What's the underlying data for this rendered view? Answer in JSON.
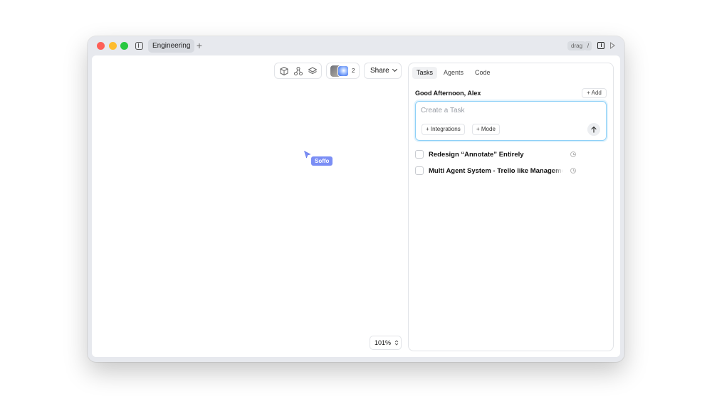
{
  "titlebar": {
    "tab_label": "Engineering",
    "add_tab_symbol": "+",
    "drag_label": "drag",
    "shortcut_label": "/"
  },
  "toolbar": {
    "icons": [
      "cube-icon",
      "nodes-icon",
      "layers-icon"
    ],
    "collaborators_count": "2",
    "share_label": "Share"
  },
  "canvas": {
    "cursor_user": "Soffo",
    "cursor_color": "#7b8ef5",
    "zoom_label": "101%"
  },
  "panel": {
    "tabs": [
      {
        "label": "Tasks",
        "active": true
      },
      {
        "label": "Agents",
        "active": false
      },
      {
        "label": "Code",
        "active": false
      }
    ],
    "greeting": "Good Afternoon, Alex",
    "add_label": "+ Add",
    "task_placeholder": "Create a Task",
    "integrations_label": "+ Integrations",
    "mode_label": "+ Mode",
    "tasks": [
      {
        "title": "Redesign “Annotate” Entirely"
      },
      {
        "title": "Multi Agent System - Trello like Management"
      }
    ],
    "focus_color": "#8dd0f7"
  }
}
